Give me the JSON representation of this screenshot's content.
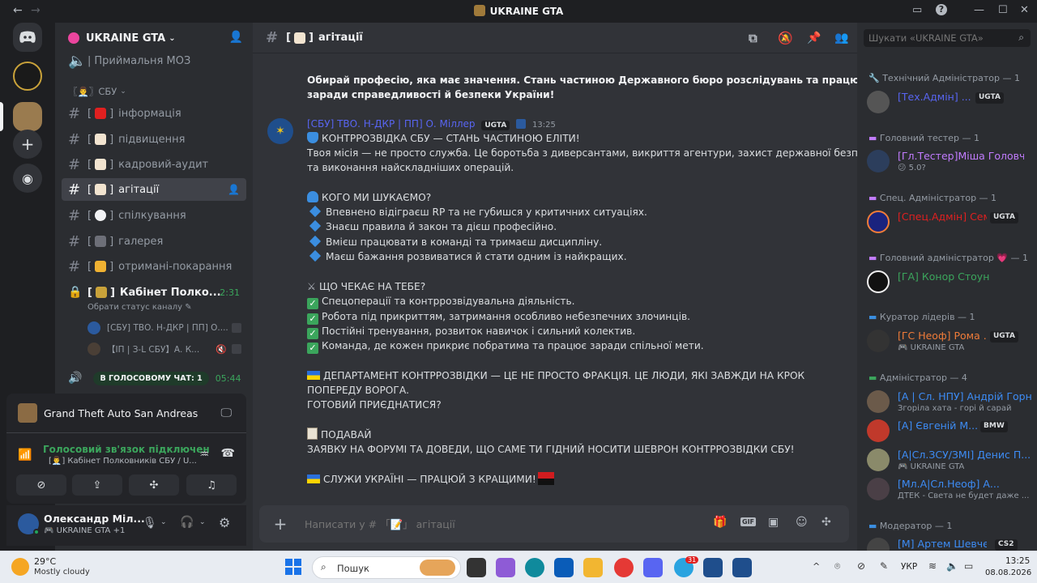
{
  "window": {
    "title": "UKRAINE GTA"
  },
  "server": {
    "name": "UKRAINE GTA"
  },
  "channels": {
    "top_voice": "Приймальня МОЗ",
    "category": "СБУ",
    "items": [
      {
        "label": "інформація"
      },
      {
        "label": "підвищення"
      },
      {
        "label": "кадровий-аудит"
      },
      {
        "label": "агітації"
      },
      {
        "label": "спілкування"
      },
      {
        "label": "галерея"
      },
      {
        "label": "отримані-покарання"
      }
    ],
    "locked_voice": {
      "label": "Кабінет Полко...",
      "time": "2:31",
      "status": "Обрати статус каналу"
    },
    "voice_users": [
      "[СБУ] ТВО. Н-ДКР | ПП] О....",
      "【ІП | З-L СБУ】А. К..."
    ],
    "voice_chat_badge": "В ГОЛОСОВОМУ ЧАТ: 1",
    "voice_chat_time": "05:44"
  },
  "voice_panel": {
    "activity": "Grand Theft Auto San Andreas",
    "status": "Голосовий зв'язок підключен",
    "channel": "[👨‍💼] Кабінет Полковників СБУ / U..."
  },
  "user": {
    "name": "Олександр Міл...",
    "server_tag": "UKRAINE GTA +1"
  },
  "header": {
    "channel": "агітації"
  },
  "message": {
    "intro_bold": [
      "Обирай професію, яка має значення. Стань частиною Державного бюро розслідувань та працюю",
      "заради справедливості й безпеки України!"
    ],
    "author": "[СБУ] ТВО. Н-ДКР | ПП] О. Міллер",
    "author_tag": "UGTA",
    "time": "13:25",
    "headline": "КОНТРРОЗВІДКА СБУ — СТАНЬ ЧАСТИНОЮ ЕЛІТИ!",
    "mission": [
      "Твоя місія — не просто служба. Це боротьба з диверсантами, викриття агентури, захист державної безпеки",
      "та виконання найскладніших операцій."
    ],
    "who_title": "КОГО МИ ШУКАЄМО?",
    "who_items": [
      "Впевнено відіграєш RP та не губишся у критичних ситуаціях.",
      "Знаєш правила й закон та дієш професійно.",
      "Вмієш працювати в команді та тримаєш дисципліну.",
      "Маєш бажання розвиватися й стати одним із найкращих."
    ],
    "what_title": "ЩО ЧЕКАЄ НА ТЕБЕ?",
    "what_items": [
      "Спецоперації та контррозвідувальна діяльність.",
      "Робота під прикриттям, затримання особливо небезпечних злочинців.",
      "Постійні тренування, розвиток навичок і сильний колектив.",
      "Команда, де кожен прикриє побратима та працює заради спільної мети."
    ],
    "dept_lines": [
      "ДЕПАРТАМЕНТ КОНТРРОЗВІДКИ — ЦЕ НЕ ПРОСТО ФРАКЦІЯ. ЦЕ ЛЮДИ, ЯКІ ЗАВЖДИ НА КРОК",
      "ПОПЕРЕДУ ВОРОГА.",
      "ГОТОВИЙ ПРИЄДНАТИСЯ?"
    ],
    "apply_title": "ПОДАВАЙ",
    "apply_text": "ЗАЯВКУ НА ФОРУМІ ТА ДОВЕДИ, ЩО САМЕ ТИ ГІДНИЙ НОСИТИ ШЕВРОН КОНТРРОЗВІДКИ СБУ!",
    "closing": "СЛУЖИ УКРАЇНІ — ПРАЦЮЙ З КРАЩИМИ!"
  },
  "composer": {
    "placeholder": "Написати у # 「📝」 агітації"
  },
  "members": {
    "search_placeholder": "Шукати «UKRAINE GTA»",
    "groups": [
      {
        "title": "Технічний Адміністратор — 1",
        "members": [
          {
            "name": "[Тех.Адмін] ...",
            "tag": "UGTA",
            "color": "#5865f2"
          }
        ]
      },
      {
        "title": "Головний тестер — 1",
        "members": [
          {
            "name": "[Гл.Тестер]Міша Головч...",
            "sub": "😕 5.0?",
            "color": "#c27cff"
          }
        ]
      },
      {
        "title": "Спец. Адміністратор — 1",
        "members": [
          {
            "name": "[Спец.Адмін] Сем...",
            "tag": "UGTA",
            "color": "#e02020"
          }
        ]
      },
      {
        "title": "Головний адміністратор 💗 — 1",
        "members": [
          {
            "name": "[ГА] Конор Стоун",
            "color": "#3ba55c"
          }
        ]
      },
      {
        "title": "Куратор лідерів — 1",
        "members": [
          {
            "name": "[ГС Неоф] Рома ...",
            "tag": "UGTA",
            "sub": "🎮 UKRAINE GTA",
            "color": "#f07c39"
          }
        ]
      },
      {
        "title": "Адміністратор — 4",
        "members": [
          {
            "name": "[А | Сл. НПУ] Андрій Горн",
            "sub": "Згоріла хата - горі й сарай",
            "color": "#3d8cf5"
          },
          {
            "name": "[А] Євгеній М...",
            "tag": "BMW",
            "color": "#3d8cf5"
          },
          {
            "name": "[А|Сл.ЗСУ/ЗМІ] Денис П...",
            "sub": "🎮 UKRAINE GTA",
            "color": "#3d8cf5"
          },
          {
            "name": "[Мл.А|Сл.Неоф] А...",
            "sub": "ДТЕК - Света не будет даже ...",
            "color": "#3d8cf5"
          }
        ]
      },
      {
        "title": "Модератор — 1",
        "members": [
          {
            "name": "[М] Артем Шевче...",
            "tag": "CS2",
            "color": "#3d8cf5"
          }
        ]
      }
    ]
  },
  "taskbar": {
    "weather_temp": "29°C",
    "weather_desc": "Mostly cloudy",
    "search": "Пошук",
    "lang": "УКР",
    "time": "13:25",
    "date": "08.08.2026",
    "telegram_badge": "31"
  }
}
